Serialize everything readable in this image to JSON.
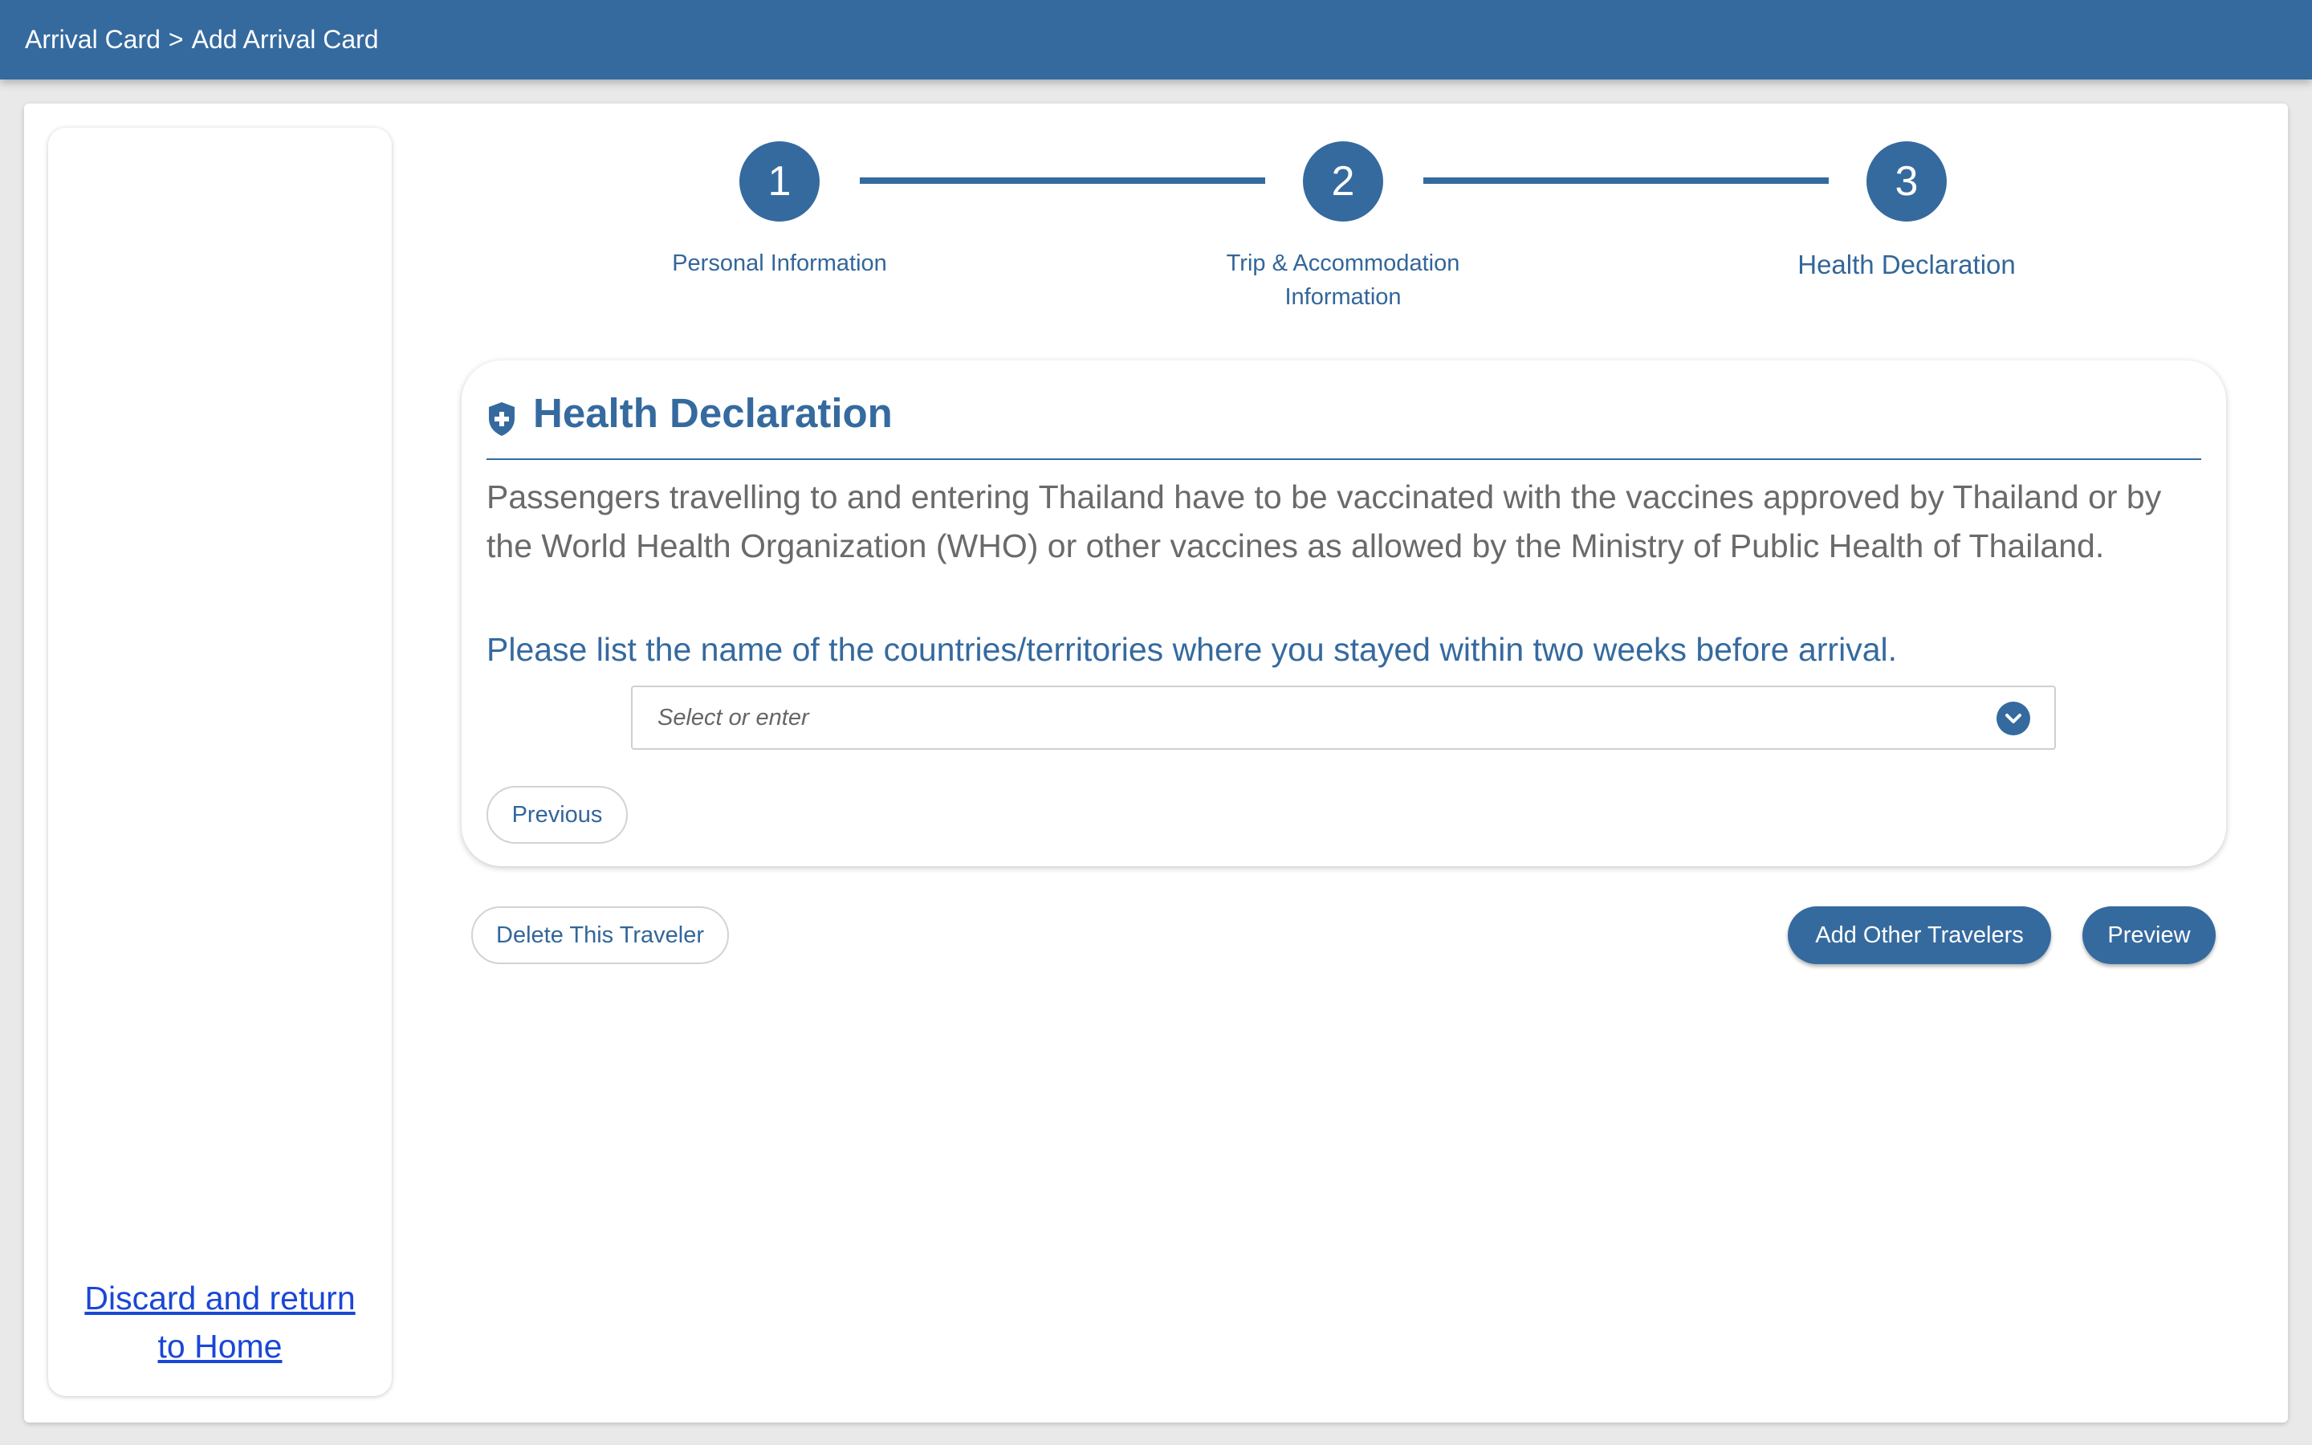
{
  "breadcrumb": {
    "items": [
      "Arrival Card",
      "Add Arrival Card"
    ],
    "separator": ">"
  },
  "sidebar": {
    "discard_link": "Discard and return to Home"
  },
  "stepper": {
    "steps": [
      {
        "number": "1",
        "label": "Personal Information"
      },
      {
        "number": "2",
        "label": "Trip & Accommodation Information"
      },
      {
        "number": "3",
        "label": "Health Declaration",
        "active": true
      }
    ]
  },
  "card": {
    "icon": "shield-plus-icon",
    "title": "Health Declaration",
    "notice": "Passengers travelling to and entering Thailand have to be vaccinated with the vaccines approved by Thailand or by the World Health Organization (WHO) or other vaccines as allowed by the Ministry of Public Health of Thailand.",
    "question": "Please list the name of the countries/territories where you stayed within two weeks before arrival.",
    "country_select": {
      "placeholder": "Select or enter",
      "icon": "chevron-down-icon"
    },
    "previous_button": "Previous"
  },
  "actions": {
    "delete_button": "Delete This Traveler",
    "add_travelers_button": "Add Other Travelers",
    "preview_button": "Preview"
  },
  "colors": {
    "primary": "#356a9f",
    "link": "#1a47d6",
    "background": "#e9e9e9",
    "text_gray": "#6a6a6a"
  }
}
